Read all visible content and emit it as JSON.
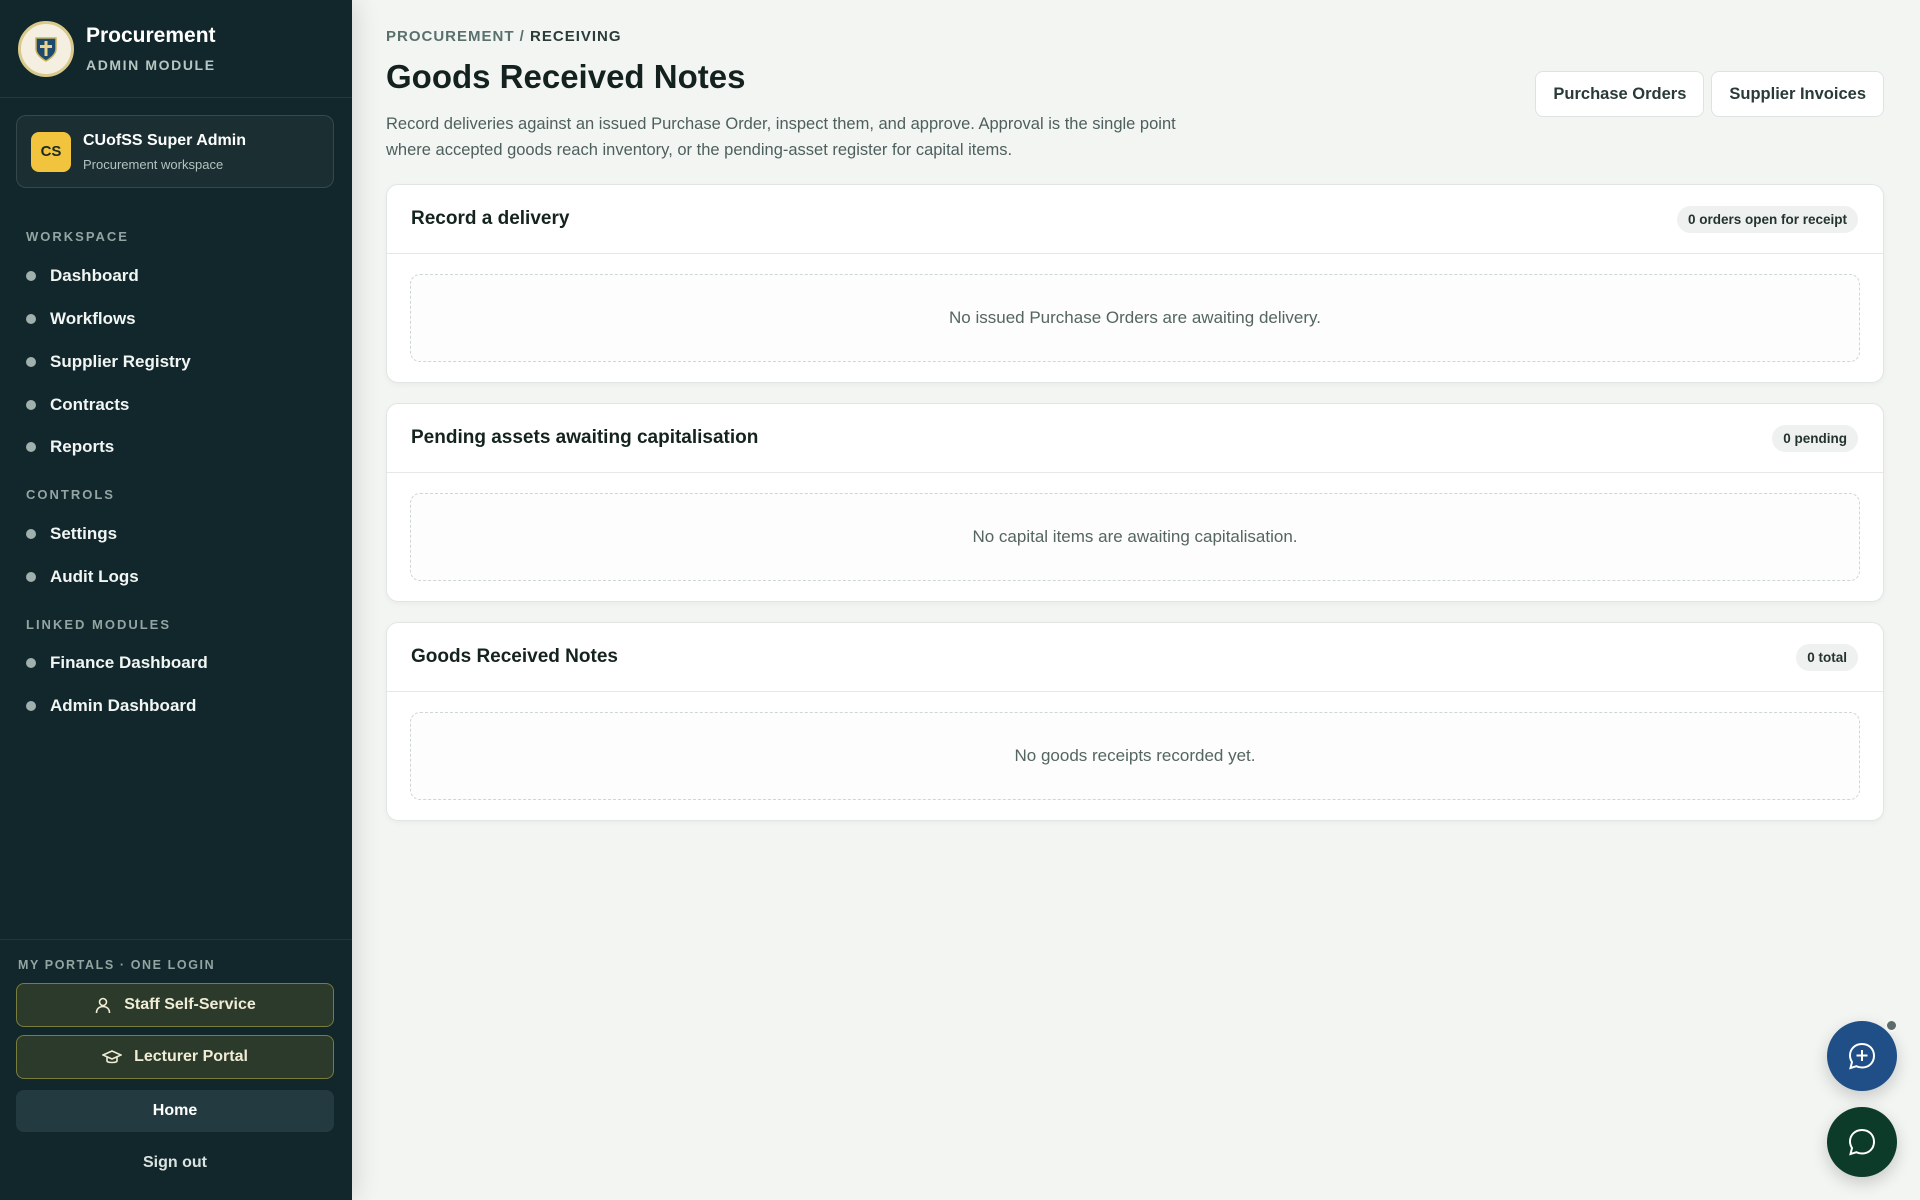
{
  "brand": {
    "title": "Procurement",
    "subtitle": "ADMIN MODULE"
  },
  "user": {
    "initials": "CS",
    "name": "CUofSS Super Admin",
    "workspace": "Procurement workspace"
  },
  "sidebar": {
    "sections": [
      {
        "label": "WORKSPACE",
        "items": [
          "Dashboard",
          "Workflows",
          "Supplier Registry",
          "Contracts",
          "Reports"
        ]
      },
      {
        "label": "CONTROLS",
        "items": [
          "Settings",
          "Audit Logs"
        ]
      },
      {
        "label": "LINKED MODULES",
        "items": [
          "Finance Dashboard",
          "Admin Dashboard"
        ]
      }
    ],
    "portals_label": "MY PORTALS · ONE LOGIN",
    "staff_portal": "Staff Self-Service",
    "lecturer_portal": "Lecturer Portal",
    "home": "Home",
    "sign_out": "Sign out"
  },
  "breadcrumb": {
    "parent": "PROCUREMENT",
    "separator": " / ",
    "current": "RECEIVING"
  },
  "page": {
    "title": "Goods Received Notes",
    "description": "Record deliveries against an issued Purchase Order, inspect them, and approve. Approval is the single point where accepted goods reach inventory, or the pending-asset register for capital items."
  },
  "actions": {
    "purchase_orders": "Purchase Orders",
    "supplier_invoices": "Supplier Invoices"
  },
  "cards": [
    {
      "title": "Record a delivery",
      "badge": "0 orders open for receipt",
      "empty": "No issued Purchase Orders are awaiting delivery."
    },
    {
      "title": "Pending assets awaiting capitalisation",
      "badge": "0 pending",
      "empty": "No capital items are awaiting capitalisation."
    },
    {
      "title": "Goods Received Notes",
      "badge": "0 total",
      "empty": "No goods receipts recorded yet."
    }
  ],
  "colors": {
    "sidebar_bg": "#12272b",
    "avatar": "#f2c43d",
    "ai_button": "#1f4f86",
    "chat_button": "#0d3b2a"
  },
  "icons": {
    "logo": "university-crest-icon",
    "staff": "person-icon",
    "lecturer": "graduation-cap-icon",
    "ai": "ai-chat-sparkle-icon",
    "chat": "chat-bubble-icon"
  }
}
